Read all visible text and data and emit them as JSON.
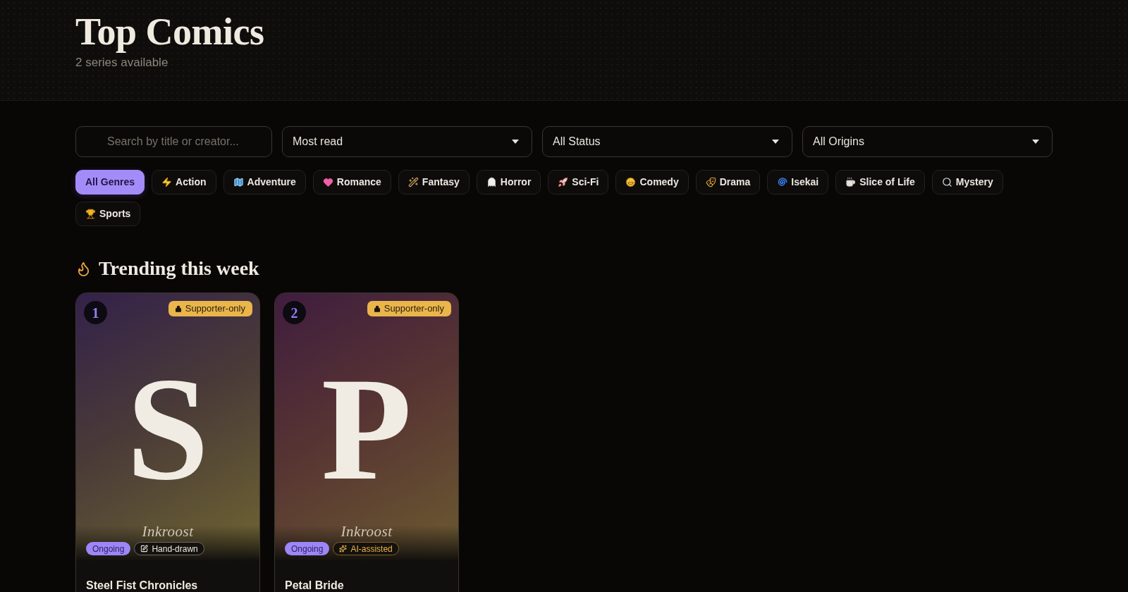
{
  "header": {
    "title": "Top Comics",
    "subtitle": "2 series available"
  },
  "filters": {
    "search": {
      "placeholder": "Search by title or creator..."
    },
    "selects": [
      {
        "value": "Most read"
      },
      {
        "value": "All Status"
      },
      {
        "value": "All Origins"
      }
    ]
  },
  "genres": [
    {
      "label": "All Genres",
      "selected": true
    },
    {
      "label": "Action",
      "selected": false
    },
    {
      "label": "Adventure",
      "selected": false
    },
    {
      "label": "Romance",
      "selected": false
    },
    {
      "label": "Fantasy",
      "selected": false
    },
    {
      "label": "Horror",
      "selected": false
    },
    {
      "label": "Sci-Fi",
      "selected": false
    },
    {
      "label": "Comedy",
      "selected": false
    },
    {
      "label": "Drama",
      "selected": false
    },
    {
      "label": "Isekai",
      "selected": false
    },
    {
      "label": "Slice of Life",
      "selected": false
    },
    {
      "label": "Mystery",
      "selected": false
    },
    {
      "label": "Sports",
      "selected": false
    }
  ],
  "trending": {
    "title": "Trending this week",
    "cards": [
      {
        "rank": "1",
        "access": "Supporter-only",
        "letter": "S",
        "publisher": "Inkroost",
        "status": "Ongoing",
        "origin": {
          "kind": "manual",
          "label": "Hand-drawn"
        },
        "title": "Steel Fist Chronicles"
      },
      {
        "rank": "2",
        "access": "Supporter-only",
        "letter": "P",
        "publisher": "Inkroost",
        "status": "Ongoing",
        "origin": {
          "kind": "ai",
          "label": "AI-assisted"
        },
        "title": "Petal Bride"
      }
    ]
  }
}
